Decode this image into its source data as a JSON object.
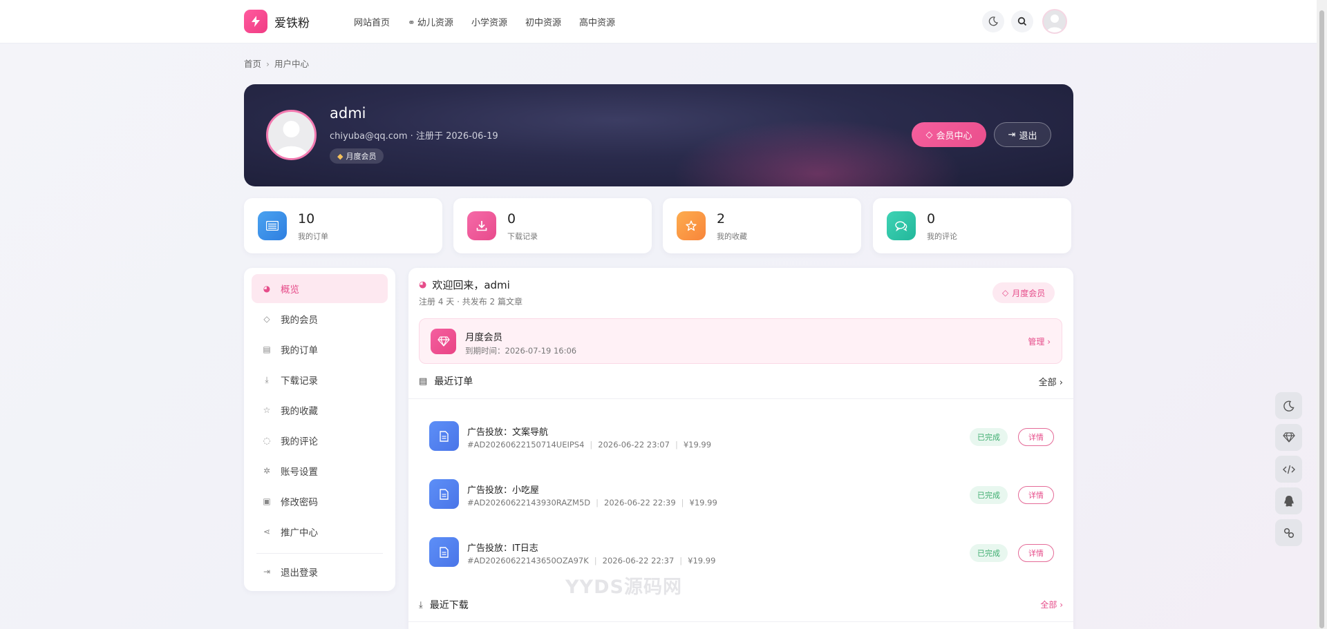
{
  "header": {
    "logo_text": "爱铁粉",
    "nav": [
      {
        "label": "网站首页",
        "prefix": ""
      },
      {
        "label": "幼儿资源",
        "prefix": "⚭"
      },
      {
        "label": "小学资源",
        "prefix": ""
      },
      {
        "label": "初中资源",
        "prefix": ""
      },
      {
        "label": "高中资源",
        "prefix": ""
      }
    ]
  },
  "breadcrumb": {
    "home": "首页",
    "sep": "›",
    "current": "用户中心"
  },
  "profile": {
    "name": "admi",
    "meta": "chiyuba@qq.com · 注册于 2026-06-19",
    "badge": "月度会员",
    "vip_button": "会员中心",
    "logout_button": "退出"
  },
  "stats": [
    {
      "value": "10",
      "label": "我的订单",
      "color": "#3f8fe6"
    },
    {
      "value": "0",
      "label": "下载记录",
      "color": "#ef5a9c"
    },
    {
      "value": "2",
      "label": "我的收藏",
      "color": "#fb9a3e"
    },
    {
      "value": "0",
      "label": "我的评论",
      "color": "#2fc6a8"
    }
  ],
  "sidebar": {
    "items": [
      {
        "label": "概览",
        "icon": "dashboard-icon"
      },
      {
        "label": "我的会员",
        "icon": "diamond-icon"
      },
      {
        "label": "我的订单",
        "icon": "list-icon"
      },
      {
        "label": "下载记录",
        "icon": "download-icon"
      },
      {
        "label": "我的收藏",
        "icon": "star-icon"
      },
      {
        "label": "我的评论",
        "icon": "comment-icon"
      },
      {
        "label": "账号设置",
        "icon": "gear-icon"
      },
      {
        "label": "修改密码",
        "icon": "lock-icon"
      },
      {
        "label": "推广中心",
        "icon": "share-icon"
      }
    ],
    "logout": "退出登录"
  },
  "main": {
    "welcome": "欢迎回来，admi",
    "welcome_sub": "注册 4 天 · 共发布 2 篇文章",
    "vip_pill": "月度会员",
    "vip_card": {
      "title": "月度会员",
      "expiry": "到期时间：2026-07-19 16:06",
      "manage": "管理 ›"
    },
    "recent_orders": {
      "title": "最近订单",
      "more": "全部 ›",
      "items": [
        {
          "title": "广告投放：文案导航",
          "no": "#AD20260622150714UEIPS4",
          "time": "2026-06-22 23:07",
          "price": "¥19.99",
          "status": "已完成",
          "detail": "详情"
        },
        {
          "title": "广告投放：小吃屋",
          "no": "#AD20260622143930RAZM5D",
          "time": "2026-06-22 22:39",
          "price": "¥19.99",
          "status": "已完成",
          "detail": "详情"
        },
        {
          "title": "广告投放：IT日志",
          "no": "#AD20260622143650OZA97K",
          "time": "2026-06-22 22:37",
          "price": "¥19.99",
          "status": "已完成",
          "detail": "详情"
        }
      ]
    },
    "recent_downloads": {
      "title": "最近下载",
      "more": "全部 ›"
    }
  },
  "watermark": "YYDS源码网",
  "floating": [
    "moon-icon",
    "diamond-icon",
    "code-icon",
    "qq-icon",
    "link-icon"
  ]
}
